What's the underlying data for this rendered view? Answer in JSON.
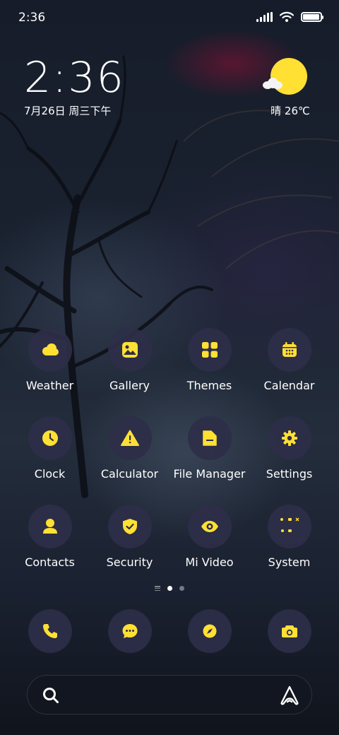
{
  "status_bar": {
    "time": "2:36",
    "battery_level": 0.95
  },
  "clock_widget": {
    "time": "2:36",
    "date": "7月26日 周三下午"
  },
  "weather_widget": {
    "condition_temp": "晴 26℃",
    "icon": "sunny-partly-cloudy-icon"
  },
  "apps": {
    "row1": [
      {
        "label": "Weather",
        "icon": "weather-icon"
      },
      {
        "label": "Gallery",
        "icon": "gallery-icon"
      },
      {
        "label": "Themes",
        "icon": "themes-icon"
      },
      {
        "label": "Calendar",
        "icon": "calendar-icon"
      }
    ],
    "row2": [
      {
        "label": "Clock",
        "icon": "clock-icon"
      },
      {
        "label": "Calculator",
        "icon": "calculator-icon"
      },
      {
        "label": "File Manager",
        "icon": "file-manager-icon"
      },
      {
        "label": "Settings",
        "icon": "settings-icon"
      }
    ],
    "row3": [
      {
        "label": "Contacts",
        "icon": "contacts-icon"
      },
      {
        "label": "Security",
        "icon": "security-icon"
      },
      {
        "label": "Mi Video",
        "icon": "mi-video-icon"
      },
      {
        "label": "System",
        "icon": "system-folder-icon"
      }
    ]
  },
  "dock": [
    {
      "icon": "phone-icon"
    },
    {
      "icon": "messages-icon"
    },
    {
      "icon": "browser-compass-icon"
    },
    {
      "icon": "camera-icon"
    }
  ],
  "page_indicator": {
    "pages": 2,
    "current": 1
  },
  "search_bar": {
    "left_icon": "search-icon",
    "right_icon": "assistant-icon"
  },
  "colors": {
    "accent": "#ffe033",
    "icon_bg": "#2e2e48",
    "text": "#ffffff"
  }
}
